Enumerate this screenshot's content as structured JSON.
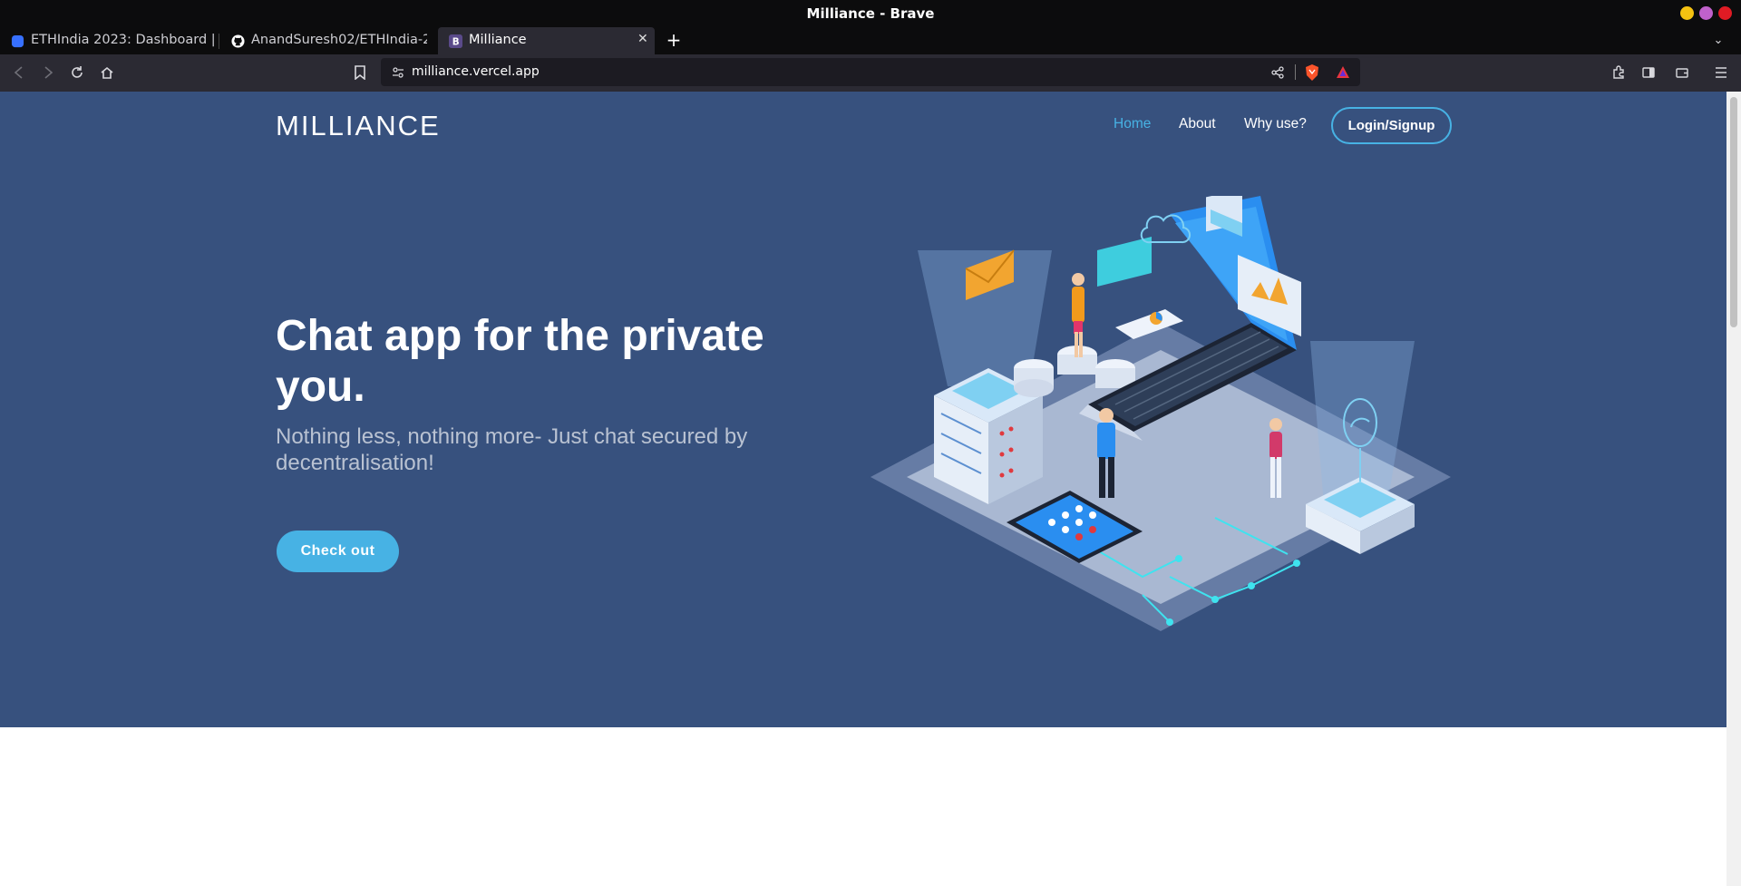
{
  "window": {
    "title": "Milliance - Brave"
  },
  "tabs": [
    {
      "label": "ETHIndia 2023: Dashboard | D"
    },
    {
      "label": "AnandSuresh02/ETHIndia-23"
    },
    {
      "label": "Milliance"
    }
  ],
  "address_bar": {
    "url": "milliance.vercel.app"
  },
  "site": {
    "logo": "MILLIANCE",
    "nav": {
      "home": "Home",
      "about": "About",
      "why": "Why use?",
      "login": "Login/Signup"
    },
    "hero": {
      "headline": "Chat app for the private you.",
      "subline": "Nothing less, nothing more- Just chat secured by decentralisation!",
      "cta": "Check out"
    }
  },
  "colors": {
    "hero_bg": "#37517e",
    "accent": "#47b2e4",
    "browser_toolbar": "#2b2a33",
    "window_buttons": [
      "#f5c211",
      "#c061cb",
      "#e01b24"
    ]
  },
  "icons": {
    "toolbar": [
      "back-icon",
      "forward-icon",
      "reload-icon",
      "home-icon",
      "bookmark-icon"
    ],
    "right_toolbar": [
      "extensions-icon",
      "sidebar-icon",
      "wallet-icon",
      "menu-icon"
    ]
  }
}
